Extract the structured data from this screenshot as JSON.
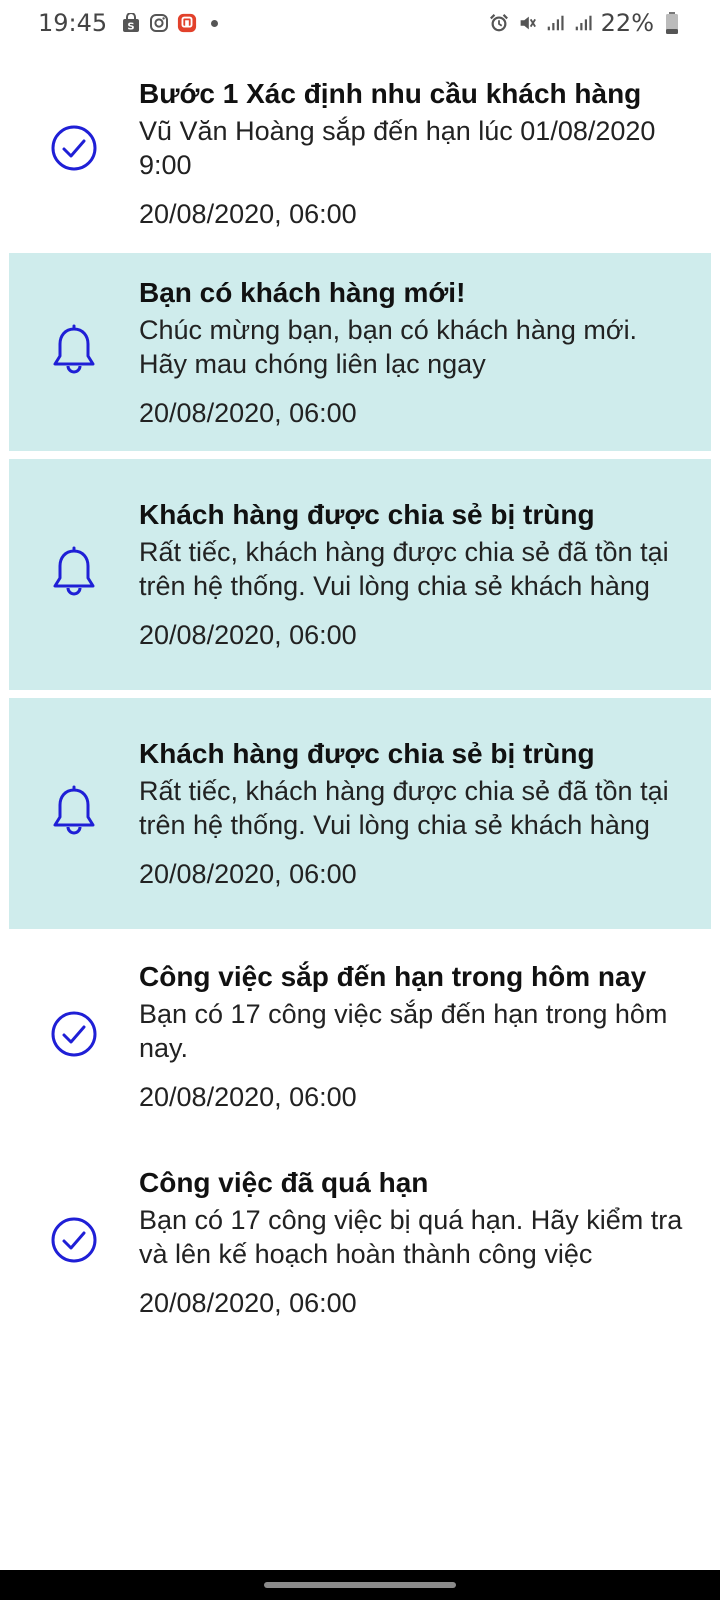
{
  "status_bar": {
    "time": "19:45",
    "left_icons": [
      "shopping-bag-icon",
      "instagram-icon",
      "app-notification-icon"
    ],
    "right_icons": [
      "alarm-icon",
      "vibrate-mute-icon",
      "signal-icon",
      "signal-icon"
    ],
    "battery_percent": "22%"
  },
  "colors": {
    "accent": "#1f1fd6",
    "unread_background": "#cfecec"
  },
  "notifications": [
    {
      "icon": "check-circle-icon",
      "unread": false,
      "title": "Bước 1 Xác định nhu cầu khách hàng",
      "body": "Vũ Văn Hoàng sắp đến hạn lúc 01/08/2020 9:00",
      "time": "20/08/2020, 06:00"
    },
    {
      "icon": "bell-icon",
      "unread": true,
      "title": "Bạn có khách hàng mới!",
      "body": "Chúc mừng bạn, bạn có khách hàng mới. Hãy mau chóng liên lạc ngay",
      "time": "20/08/2020, 06:00"
    },
    {
      "icon": "bell-icon",
      "unread": true,
      "title": "Khách hàng được chia sẻ bị trùng",
      "body": "Rất tiếc, khách hàng được chia sẻ đã tồn tại trên hệ thống. Vui lòng chia sẻ khách hàng",
      "time": "20/08/2020, 06:00"
    },
    {
      "icon": "bell-icon",
      "unread": true,
      "title": "Khách hàng được chia sẻ bị trùng",
      "body": "Rất tiếc, khách hàng được chia sẻ đã tồn tại trên hệ thống. Vui lòng chia sẻ khách hàng",
      "time": "20/08/2020, 06:00"
    },
    {
      "icon": "check-circle-icon",
      "unread": false,
      "title": "Công việc sắp đến hạn trong hôm nay",
      "body": "Bạn có 17 công việc sắp đến hạn trong hôm nay.",
      "time": "20/08/2020, 06:00"
    },
    {
      "icon": "check-circle-icon",
      "unread": false,
      "title": "Công việc đã quá hạn",
      "body": "Bạn có 17 công việc bị quá hạn. Hãy kiểm tra và lên kế hoạch hoàn thành công việc",
      "time": "20/08/2020, 06:00"
    }
  ]
}
